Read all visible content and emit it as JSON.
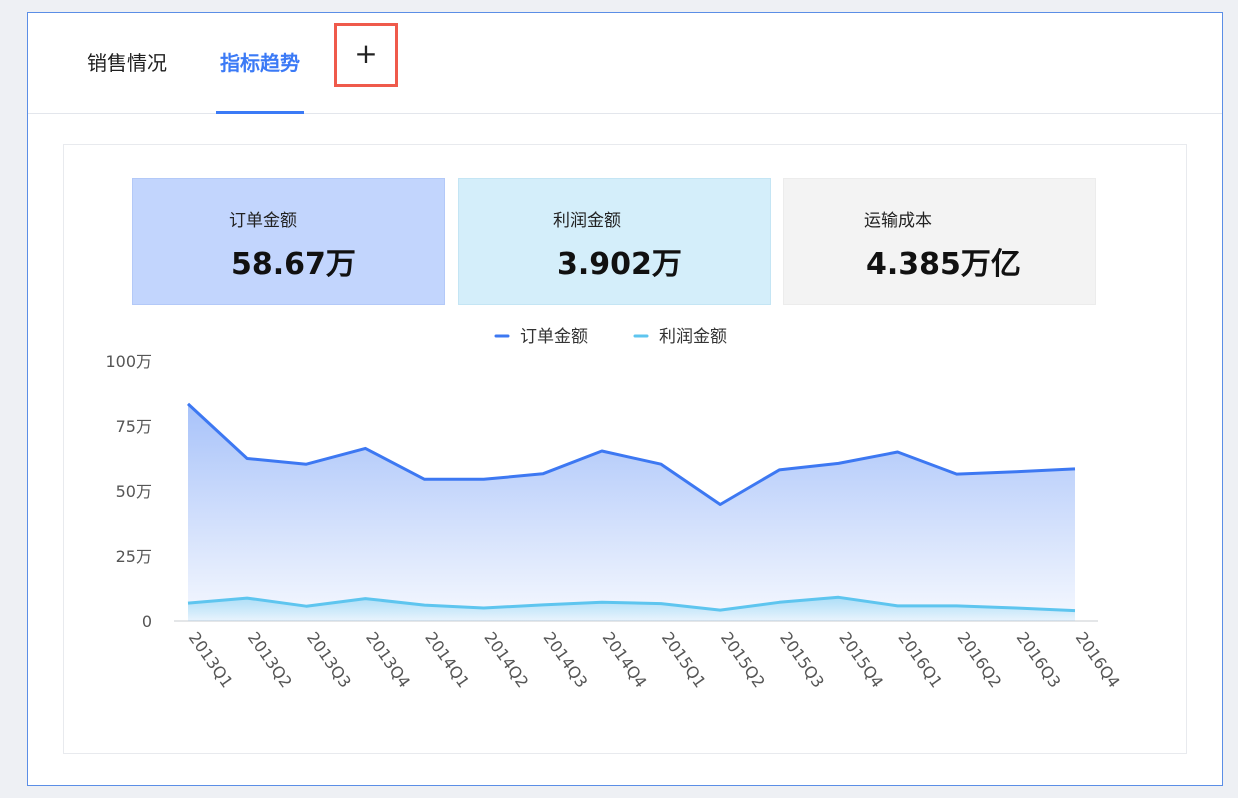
{
  "tabs": {
    "sales_label": "销售情况",
    "trend_label": "指标趋势",
    "add_label": "+"
  },
  "kpis": {
    "order": {
      "label": "订单金额",
      "value": "58.67万"
    },
    "profit": {
      "label": "利润金额",
      "value": "3.902万"
    },
    "cost": {
      "label": "运输成本",
      "value": "4.385万亿"
    }
  },
  "colors": {
    "accent": "#3b7af6",
    "order_series": "#3d78f2",
    "profit_series": "#5ec5ef",
    "highlight_box": "#ef5a4b"
  },
  "chart_data": {
    "type": "area",
    "categories": [
      "2013Q1",
      "2013Q2",
      "2013Q3",
      "2013Q4",
      "2014Q1",
      "2014Q2",
      "2014Q3",
      "2014Q4",
      "2015Q1",
      "2015Q2",
      "2015Q3",
      "2015Q4",
      "2016Q1",
      "2016Q2",
      "2016Q3",
      "2016Q4"
    ],
    "series": [
      {
        "name": "订单金额",
        "color": "#3d78f2",
        "values": [
          835000,
          625000,
          603000,
          664000,
          545000,
          545000,
          566000,
          654000,
          603000,
          448000,
          581000,
          606000,
          650000,
          565000,
          574000,
          585000
        ]
      },
      {
        "name": "利润金额",
        "color": "#5ec5ef",
        "values": [
          69000,
          88000,
          57000,
          86000,
          61000,
          50000,
          62000,
          72000,
          67000,
          42000,
          72000,
          91000,
          58000,
          58000,
          50000,
          40000
        ]
      }
    ],
    "yticks": [
      "0",
      "25万",
      "50万",
      "75万",
      "100万"
    ],
    "ylim": [
      0,
      1000000
    ],
    "legend_position": "top-center",
    "grid": false
  }
}
